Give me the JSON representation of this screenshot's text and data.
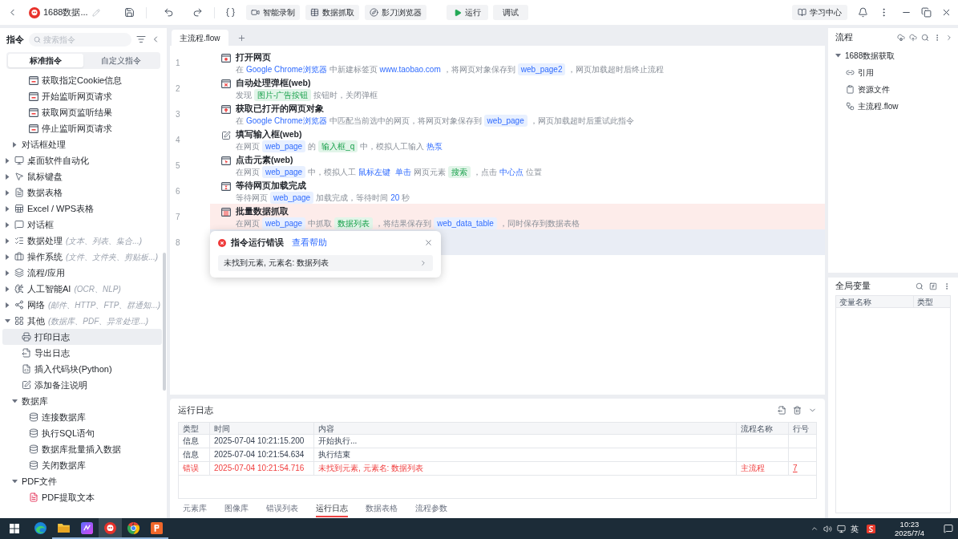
{
  "title_bar": {
    "project": "1688数据...",
    "tools": [
      {
        "label": "智能录制",
        "kind": "record"
      },
      {
        "label": "数据抓取",
        "kind": "grab"
      },
      {
        "label": "影刀浏览器",
        "kind": "browser"
      }
    ],
    "run": "运行",
    "debug": "调试",
    "learn": "学习中心"
  },
  "sidebar": {
    "title": "指令",
    "search": {
      "placeholder": "搜索指令"
    },
    "tabs": [
      {
        "label": "标准指令",
        "selected": true
      },
      {
        "label": "自定义指令",
        "selected": false
      }
    ],
    "tree": [
      {
        "children": [
          {
            "children": [
              {
                "label": "获取指定Cookie信息",
                "kind": "web",
                "selected": false
              },
              {
                "label": "开始监听网页请求",
                "kind": "web",
                "selected": false
              },
              {
                "label": "获取网页监听结果",
                "kind": "web",
                "selected": false
              },
              {
                "label": "停止监听网页请求",
                "kind": "web",
                "selected": false
              }
            ]
          },
          {
            "label": "对话框处理",
            "kind": "plain",
            "expanded": false,
            "selected": false
          }
        ]
      },
      {
        "label": "桌面软件自动化",
        "kind": "monitor",
        "expanded": false,
        "selected": false
      },
      {
        "label": "鼠标键盘",
        "kind": "cursor",
        "expanded": false,
        "selected": false
      },
      {
        "label": "数据表格",
        "kind": "sheet",
        "expanded": false,
        "selected": false
      },
      {
        "label": "Excel / WPS表格",
        "kind": "excel",
        "expanded": false,
        "selected": false
      },
      {
        "label": "对话框",
        "kind": "dialog",
        "expanded": false,
        "selected": false
      },
      {
        "label": "数据处理",
        "hint": "(文本、列表、集合...)",
        "kind": "data",
        "expanded": false,
        "selected": false
      },
      {
        "label": "操作系统",
        "hint": "(文件、文件夹、剪贴板...)",
        "kind": "system",
        "expanded": false,
        "selected": false
      },
      {
        "label": "流程/应用",
        "kind": "layers",
        "expanded": false,
        "selected": false
      },
      {
        "label": "人工智能AI",
        "hint": "(OCR、NLP)",
        "kind": "ai",
        "expanded": false,
        "selected": false
      },
      {
        "label": "网络",
        "hint": "(邮件、HTTP、FTP、群通知...)",
        "kind": "network",
        "expanded": false,
        "selected": false
      },
      {
        "label": "其他",
        "hint": "(数据库、PDF、异常处理...)",
        "kind": "grid",
        "expanded": true,
        "selected": false,
        "children": [
          {
            "label": "打印日志",
            "kind": "print",
            "selected": true
          },
          {
            "label": "导出日志",
            "kind": "export",
            "selected": false
          },
          {
            "label": "插入代码块(Python)",
            "kind": "code",
            "selected": false
          },
          {
            "label": "添加备注说明",
            "kind": "note",
            "selected": false
          },
          {
            "label": "数据库",
            "kind": "plain",
            "expanded": true,
            "selected": false,
            "children": [
              {
                "label": "连接数据库",
                "kind": "database",
                "selected": false
              },
              {
                "label": "执行SQL语句",
                "kind": "database",
                "selected": false
              },
              {
                "label": "数据库批量插入数据",
                "kind": "database",
                "selected": false
              },
              {
                "label": "关闭数据库",
                "kind": "database",
                "selected": false
              }
            ]
          },
          {
            "label": "PDF文件",
            "kind": "plain",
            "expanded": true,
            "selected": false,
            "children": [
              {
                "label": "PDF提取文本",
                "kind": "pdf",
                "selected": false
              }
            ]
          }
        ]
      }
    ]
  },
  "editor": {
    "tabs": [
      {
        "label": "主流程.flow",
        "selected": true
      }
    ],
    "steps": [
      {
        "line": "1",
        "kind": "open",
        "title": "打开网页",
        "selected": false,
        "error": false,
        "description": [
          {
            "text": "在",
            "kind": "text"
          },
          {
            "text": "Google Chrome浏览器",
            "kind": "value"
          },
          {
            "text": "中新建标签页",
            "kind": "text"
          },
          {
            "text": "www.taobao.com",
            "kind": "value"
          },
          {
            "text": "，将网页对象保存到",
            "kind": "text"
          },
          {
            "text": "web_page2",
            "kind": "variable"
          },
          {
            "text": "，网页加载超时后终止流程",
            "kind": "text"
          }
        ]
      },
      {
        "line": "2",
        "kind": "popup",
        "title": "自动处理弹框(web)",
        "selected": false,
        "error": false,
        "description": [
          {
            "text": "发现",
            "kind": "text"
          },
          {
            "text": "图片-广告按钮",
            "kind": "element"
          },
          {
            "text": "按钮时，关闭弹框",
            "kind": "text"
          }
        ]
      },
      {
        "line": "3",
        "kind": "get",
        "title": "获取已打开的网页对象",
        "selected": false,
        "error": false,
        "description": [
          {
            "text": "在",
            "kind": "text"
          },
          {
            "text": "Google Chrome浏览器",
            "kind": "value"
          },
          {
            "text": "中匹配当前选中的网页，将网页对象保存到",
            "kind": "text"
          },
          {
            "text": "web_page",
            "kind": "variable"
          },
          {
            "text": "，网页加载超时后重试此指令",
            "kind": "text"
          }
        ]
      },
      {
        "line": "4",
        "kind": "input",
        "title": "填写输入框(web)",
        "selected": false,
        "error": false,
        "description": [
          {
            "text": "在网页",
            "kind": "text"
          },
          {
            "text": "web_page",
            "kind": "variable"
          },
          {
            "text": "的",
            "kind": "text"
          },
          {
            "text": "输入框_q",
            "kind": "element"
          },
          {
            "text": "中，模拟人工输入",
            "kind": "text"
          },
          {
            "text": "热泵",
            "kind": "value"
          }
        ]
      },
      {
        "line": "5",
        "kind": "click",
        "title": "点击元素(web)",
        "selected": false,
        "error": false,
        "description": [
          {
            "text": "在网页",
            "kind": "text"
          },
          {
            "text": "web_page",
            "kind": "variable"
          },
          {
            "text": "中，模拟人工",
            "kind": "text"
          },
          {
            "text": "鼠标左键",
            "kind": "value"
          },
          {
            "text": "单击",
            "kind": "value"
          },
          {
            "text": "网页元素",
            "kind": "text"
          },
          {
            "text": "搜索",
            "kind": "element"
          },
          {
            "text": "，点击",
            "kind": "text"
          },
          {
            "text": "中心点",
            "kind": "value"
          },
          {
            "text": "位置",
            "kind": "text"
          }
        ]
      },
      {
        "line": "6",
        "kind": "wait",
        "title": "等待网页加载完成",
        "selected": false,
        "error": false,
        "description": [
          {
            "text": "等待网页",
            "kind": "text"
          },
          {
            "text": "web_page",
            "kind": "variable"
          },
          {
            "text": "加载完成，等待时间",
            "kind": "text"
          },
          {
            "text": "20",
            "kind": "value"
          },
          {
            "text": "秒",
            "kind": "text"
          }
        ]
      },
      {
        "line": "7",
        "kind": "grab",
        "title": "批量数据抓取",
        "selected": false,
        "error": true,
        "description": [
          {
            "text": "在网页",
            "kind": "text"
          },
          {
            "text": "web_page",
            "kind": "variable"
          },
          {
            "text": "中抓取",
            "kind": "text"
          },
          {
            "text": "数据列表",
            "kind": "element"
          },
          {
            "text": "，将结果保存到",
            "kind": "text"
          },
          {
            "text": "web_data_table",
            "kind": "variable"
          },
          {
            "text": "，同时保存到数据表格",
            "kind": "text"
          }
        ]
      },
      {
        "line": "8",
        "selected": true,
        "error": false
      }
    ],
    "error_popup": {
      "title": "指令运行错误",
      "help_link": "查看帮助",
      "message": "未找到元素, 元素名: 数据列表"
    }
  },
  "log": {
    "title": "运行日志",
    "columns": [
      "类型",
      "时间",
      "内容",
      "流程名称",
      "行号"
    ],
    "rows": [
      {
        "kind": "info",
        "type": "信息",
        "time": "2025-07-04 10:21:15.200",
        "content": "开始执行..."
      },
      {
        "kind": "info",
        "type": "信息",
        "time": "2025-07-04 10:21:54.634",
        "content": "执行结束"
      },
      {
        "kind": "error",
        "type": "错误",
        "time": "2025-07-04 10:21:54.716",
        "content": "未找到元素, 元素名: 数据列表",
        "flow": "主流程",
        "line": "7"
      }
    ],
    "tabs": [
      {
        "label": "元素库",
        "selected": false
      },
      {
        "label": "图像库",
        "selected": false
      },
      {
        "label": "错误列表",
        "selected": false
      },
      {
        "label": "运行日志",
        "selected": true
      },
      {
        "label": "数据表格",
        "selected": false
      },
      {
        "label": "流程参数",
        "selected": false
      }
    ]
  },
  "flow_panel": {
    "title": "流程",
    "tree": [
      {
        "label": "1688数据获取",
        "expanded": true,
        "selected": false,
        "children": [
          {
            "label": "引用",
            "kind": "reference",
            "selected": false
          },
          {
            "label": "资源文件",
            "kind": "resources",
            "selected": false
          },
          {
            "label": "主流程.flow",
            "kind": "flow",
            "selected": false
          }
        ]
      }
    ]
  },
  "variables": {
    "title": "全局变量",
    "columns": [
      "变量名称",
      "类型"
    ]
  },
  "taskbar": {
    "apps": [
      {
        "kind": "wave",
        "running": false,
        "active": false
      },
      {
        "kind": "folder",
        "running": true,
        "active": false
      },
      {
        "kind": "gradient",
        "running": true,
        "active": false
      },
      {
        "kind": "robot",
        "running": true,
        "active": true
      },
      {
        "kind": "wheel",
        "running": true,
        "active": false
      },
      {
        "kind": "slides",
        "running": true,
        "active": false
      }
    ],
    "language": "英",
    "time": "10:23",
    "date": "2025/7/4"
  }
}
